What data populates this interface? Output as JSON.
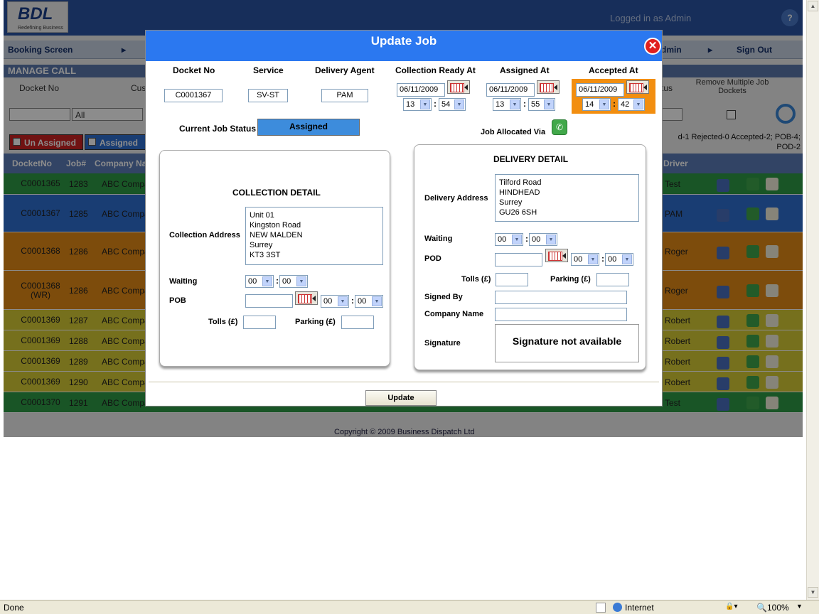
{
  "app": {
    "logo": "BDL",
    "logo_tagline": "Redefining Business",
    "logged_in": "Logged in as Admin",
    "help": "?",
    "nav": {
      "booking": "Booking Screen",
      "admin": "dmin",
      "signout": "Sign Out"
    },
    "section_title": "MANAGE CALL",
    "filter": {
      "docket_no": "Docket No",
      "cus": "Cus",
      "tus": "tus",
      "remove_multiple": "Remove Multiple Job Dockets",
      "all": "All"
    },
    "tabs": [
      {
        "label": "Un Assigned",
        "color": "#cc2222"
      },
      {
        "label": "Assigned",
        "color": "#2e6fd1"
      }
    ],
    "counts": "d-1  Rejected-0  Accepted-2;  POB-4;  POD-2",
    "table_headers": {
      "docket": "DocketNo",
      "job": "Job#",
      "company": "Company Na",
      "driver": "Driver"
    },
    "rows": [
      {
        "docket": "C0001365",
        "job": "1283",
        "company": "ABC Compan",
        "driver": "Test",
        "color": "#2e9b46"
      },
      {
        "docket": "C0001367",
        "job": "1285",
        "company": "ABC Compan",
        "driver": "PAM",
        "color": "#2e6fd1"
      },
      {
        "docket": "C0001368",
        "job": "1286",
        "company": "ABC Compan",
        "driver": "Roger",
        "color": "#e38a16"
      },
      {
        "docket": "C0001368 (WR)",
        "job": "1286",
        "company": "ABC Compan",
        "driver": "Roger",
        "color": "#e38a16"
      },
      {
        "docket": "C0001369",
        "job": "1287",
        "company": "ABC Compan",
        "driver": "Robert",
        "color": "#d8cc35"
      },
      {
        "docket": "C0001369",
        "job": "1288",
        "company": "ABC Compan",
        "driver": "Robert",
        "color": "#d8cc35"
      },
      {
        "docket": "C0001369",
        "job": "1289",
        "company": "ABC Compan",
        "driver": "Robert",
        "color": "#d8cc35"
      },
      {
        "docket": "C0001369",
        "job": "1290",
        "company": "ABC Compan",
        "driver": "Robert",
        "color": "#d8cc35"
      },
      {
        "docket": "C0001370",
        "job": "1291",
        "company": "ABC Compan",
        "driver": "Test",
        "color": "#2e9b46"
      }
    ],
    "copyright": "Copyright © 2009 Business Dispatch Ltd"
  },
  "modal": {
    "title": "Update Job",
    "headers": {
      "docket": "Docket No",
      "service": "Service",
      "agent": "Delivery Agent",
      "ready": "Collection Ready At",
      "assigned": "Assigned At",
      "accepted": "Accepted At"
    },
    "values": {
      "docket": "C0001367",
      "service": "SV-ST",
      "agent": "PAM"
    },
    "ready": {
      "date": "06/11/2009",
      "hh": "13",
      "mm": "54"
    },
    "assigned": {
      "date": "06/11/2009",
      "hh": "13",
      "mm": "55"
    },
    "accepted": {
      "date": "06/11/2009",
      "hh": "14",
      "mm": "42"
    },
    "status_label": "Current Job Status",
    "status_value": "Assigned",
    "allocated_via": "Job Allocated Via",
    "collection": {
      "title": "COLLECTION DETAIL",
      "address_label": "Collection Address",
      "address": "Unit 01\nKingston Road\nNEW MALDEN\nSurrey\nKT3 3ST",
      "waiting_label": "Waiting",
      "waiting_hh": "00",
      "waiting_mm": "00",
      "pob_label": "POB",
      "pob_hh": "00",
      "pob_mm": "00",
      "tolls_label": "Tolls (£)",
      "parking_label": "Parking (£)"
    },
    "delivery": {
      "title": "DELIVERY DETAIL",
      "address_label": "Delivery Address",
      "address": "Tilford Road\nHINDHEAD\nSurrey\nGU26 6SH",
      "waiting_label": "Waiting",
      "waiting_hh": "00",
      "waiting_mm": "00",
      "pod_label": "POD",
      "pod_hh": "00",
      "pod_mm": "00",
      "tolls_label": "Tolls (£)",
      "parking_label": "Parking (£)",
      "signed_by_label": "Signed By",
      "company_label": "Company Name",
      "signature_label": "Signature",
      "signature_text": "Signature not available"
    },
    "update_button": "Update"
  },
  "statusbar": {
    "left": "Done",
    "zone": "Internet",
    "zoom": "100%"
  }
}
